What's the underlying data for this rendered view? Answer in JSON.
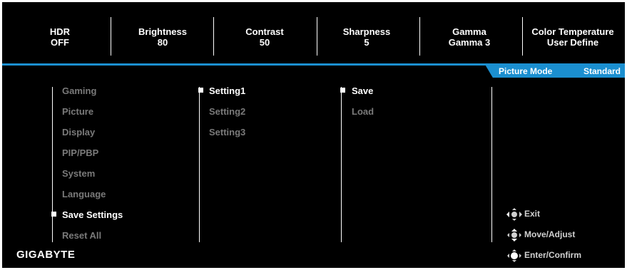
{
  "status": [
    {
      "label": "HDR",
      "value": "OFF"
    },
    {
      "label": "Brightness",
      "value": "80"
    },
    {
      "label": "Contrast",
      "value": "50"
    },
    {
      "label": "Sharpness",
      "value": "5"
    },
    {
      "label": "Gamma",
      "value": "Gamma 3"
    },
    {
      "label": "Color Temperature",
      "value": "User Define"
    }
  ],
  "picture_mode": {
    "label": "Picture Mode",
    "value": "Standard"
  },
  "menu": {
    "main": [
      "Gaming",
      "Picture",
      "Display",
      "PIP/PBP",
      "System",
      "Language",
      "Save Settings",
      "Reset All"
    ],
    "settings": [
      "Setting1",
      "Setting2",
      "Setting3"
    ],
    "actions": [
      "Save",
      "Load"
    ]
  },
  "brand": "GIGABYTE",
  "hints": {
    "exit": "Exit",
    "move": "Move/Adjust",
    "confirm": "Enter/Confirm"
  },
  "colors": {
    "accent": "#1b8fd0",
    "background": "#000000",
    "inactive_text": "#7a7a7a"
  }
}
